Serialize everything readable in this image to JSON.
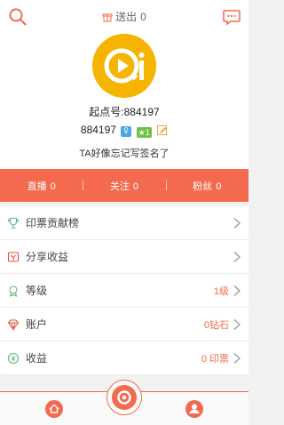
{
  "header": {
    "sent_label": "送出",
    "sent_count": "0"
  },
  "profile": {
    "qidian_id": "起点号:884197",
    "user_id": "884197",
    "badge_level": "1",
    "signature": "TA好像忘记写签名了"
  },
  "stats": [
    {
      "label": "直播",
      "value": "0"
    },
    {
      "label": "关注",
      "value": "0"
    },
    {
      "label": "粉丝",
      "value": "0"
    }
  ],
  "menu": [
    {
      "label": "印票贡献榜",
      "value": "",
      "icon": "trophy-icon"
    },
    {
      "label": "分享收益",
      "value": "",
      "icon": "share-income-icon"
    },
    {
      "label": "等级",
      "value": "1级",
      "icon": "level-icon"
    },
    {
      "label": "账户",
      "value": "0钻石",
      "icon": "diamond-icon"
    },
    {
      "label": "收益",
      "value": "0 印票",
      "icon": "income-icon"
    }
  ],
  "colors": {
    "accent": "#f36a4f",
    "avatar_bg": "#f5b400"
  },
  "tabs": [
    "home-icon",
    "live-camera-icon",
    "profile-icon"
  ]
}
